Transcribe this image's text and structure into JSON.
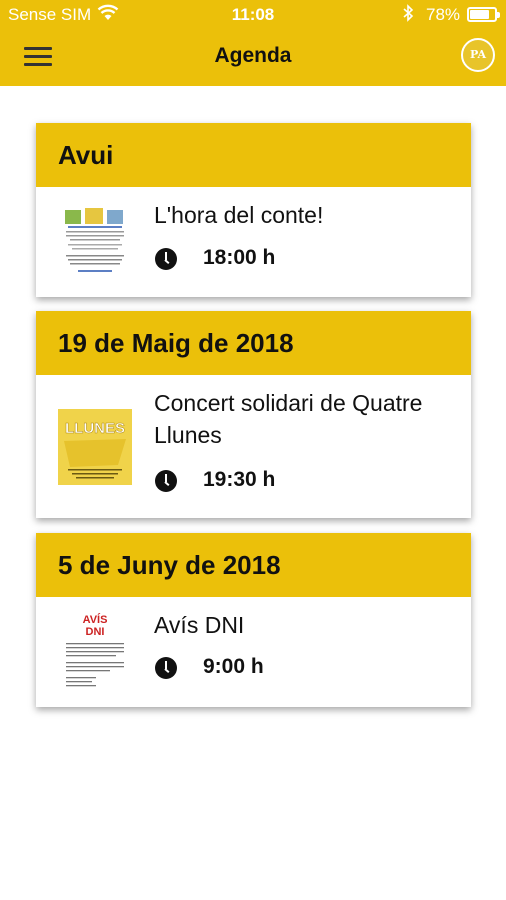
{
  "status_bar": {
    "carrier": "Sense SIM",
    "time": "11:08",
    "battery": "78%",
    "battery_level": 0.78
  },
  "header": {
    "title": "Agenda",
    "menu_icon": "hamburger-menu-icon",
    "logo_text": "PA",
    "accent_color": "#ebc00a"
  },
  "events": [
    {
      "date_label": "Avui",
      "title": "L'hora del conte!",
      "time": "18:00 h",
      "thumbnail": "storytime-poster"
    },
    {
      "date_label": "19 de Maig de 2018",
      "title": "Concert solidari de Quatre Llunes",
      "time": "19:30 h",
      "thumbnail": "llunes-poster",
      "thumbnail_text": "LLUNES"
    },
    {
      "date_label": "5 de Juny de 2018",
      "title": "Avís DNI",
      "time": "9:00 h",
      "thumbnail": "dni-notice",
      "thumbnail_text_1": "AVÍS",
      "thumbnail_text_2": "DNI"
    }
  ]
}
